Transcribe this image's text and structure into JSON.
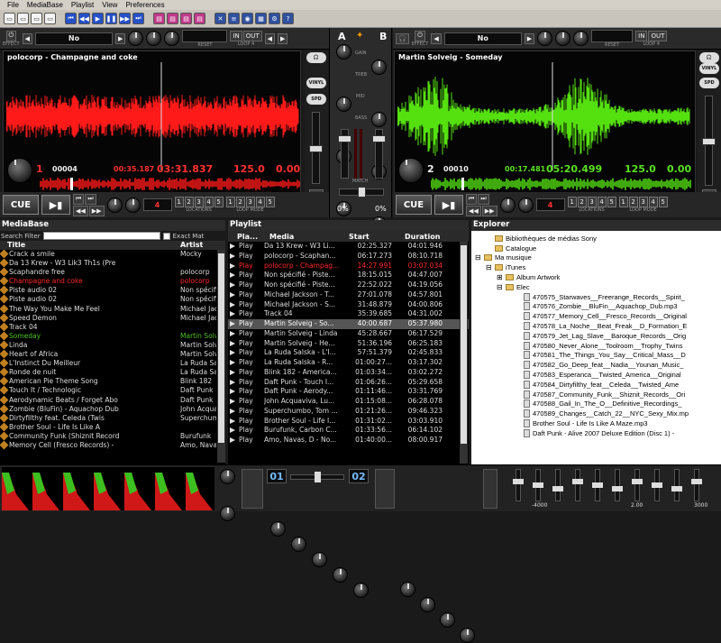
{
  "menu": [
    "File",
    "MediaBase",
    "Playlist",
    "View",
    "Preferences"
  ],
  "deckA": {
    "effect": "No",
    "effect_label": "EFFECT",
    "reset_label": "RESET",
    "in_label": "IN",
    "out_label": "OUT",
    "loop_label": "LOOP 4",
    "title": "polocorp - Champagne and coke",
    "deck_number": "1",
    "beat_counter": "00004",
    "elapsed": "00:35.187",
    "remaining": "03:31.837",
    "bpm": "125.0",
    "pitch": "0.00",
    "vinyl_label": "VINYL",
    "spd_label": "SPD",
    "cue_label": "CUE",
    "loop_len": "4",
    "loop_numbers": [
      "1",
      "2",
      "3",
      "4",
      "5"
    ],
    "locations_label": "LOCATIONS",
    "loop_mode_label": "LOOP MODE",
    "wave_color": "#ff1a1a"
  },
  "deckB": {
    "effect": "No",
    "effect_label": "EFFECT",
    "reset_label": "RESET",
    "in_label": "IN",
    "out_label": "OUT",
    "loop_label": "LOOP 4",
    "title": "Martin Solveig - Someday",
    "deck_number": "2",
    "beat_counter": "00010",
    "elapsed": "00:17.481",
    "remaining": "05:20.499",
    "bpm": "125.0",
    "pitch": "0.00",
    "vinyl_label": "VINYL",
    "spd_label": "SPD",
    "cue_label": "CUE",
    "loop_len": "4",
    "loop_numbers": [
      "1",
      "2",
      "3",
      "4",
      "5"
    ],
    "locations_label": "LOCATIONS",
    "loop_mode_label": "LOOP MODE",
    "wave_color": "#55e010"
  },
  "mixer": {
    "a_label": "A",
    "b_label": "B",
    "gain_label": "GAIN",
    "treb_label": "TREB",
    "mid_label": "MID",
    "bass_label": "BASS",
    "match_label": "MATCH",
    "pitch_a": "0%",
    "pitch_b": "0%"
  },
  "mediabase": {
    "title": "MediaBase",
    "search_label": "Search Filter",
    "exact_label": "Exact Mat",
    "col_title": "Title",
    "col_artist": "Artist",
    "rows": [
      {
        "title": "Crack a smile",
        "artist": "Mocky",
        "color": "#dddddd"
      },
      {
        "title": "Da 13 Krew - W3 Lik3 Th1s (Pre",
        "artist": "",
        "color": "#dddddd"
      },
      {
        "title": "Scaphandre free",
        "artist": "polocorp",
        "color": "#dddddd"
      },
      {
        "title": "Champagne and coke",
        "artist": "polocorp",
        "color": "#ff2a2a"
      },
      {
        "title": "Piste audio 02",
        "artist": "Non spécifié",
        "color": "#dddddd"
      },
      {
        "title": "Piste audio 02",
        "artist": "Non spécifié",
        "color": "#dddddd"
      },
      {
        "title": "The Way You Make Me Feel",
        "artist": "Michael Jackson",
        "color": "#dddddd"
      },
      {
        "title": "Speed Demon",
        "artist": "Michael Jackson",
        "color": "#dddddd"
      },
      {
        "title": "Track 04",
        "artist": "",
        "color": "#dddddd"
      },
      {
        "title": "Someday",
        "artist": "Martin Solveig",
        "color": "#4cc020"
      },
      {
        "title": "Linda",
        "artist": "Martin Solveig",
        "color": "#dddddd"
      },
      {
        "title": "Heart of Africa",
        "artist": "Martin Solveig",
        "color": "#dddddd"
      },
      {
        "title": "L'Instinct Du Meilleur",
        "artist": "La Ruda Salska",
        "color": "#dddddd"
      },
      {
        "title": "Ronde de nuit",
        "artist": "La Ruda Salska",
        "color": "#dddddd"
      },
      {
        "title": "American Pie Theme Song",
        "artist": "Blink 182",
        "color": "#dddddd"
      },
      {
        "title": "Touch It / Technologic",
        "artist": "Daft Punk",
        "color": "#dddddd"
      },
      {
        "title": "Aerodynamic Beats / Forget Abo",
        "artist": "Daft Punk",
        "color": "#dddddd"
      },
      {
        "title": "Zombie (BluFin) - Aquachop Dub",
        "artist": "John Acquaviva",
        "color": "#dddddd"
      },
      {
        "title": "Dirtyfilthy feat. Celeda (Twis",
        "artist": "Superchumbo",
        "color": "#dddddd"
      },
      {
        "title": "Brother Soul - Life Is Like A",
        "artist": "",
        "color": "#dddddd"
      },
      {
        "title": "Community Funk (Shiznit Record",
        "artist": "Burufunk",
        "color": "#dddddd"
      },
      {
        "title": "Memory Cell (Fresco Records) -",
        "artist": "Amo, Navas",
        "color": "#dddddd"
      }
    ]
  },
  "playlist": {
    "title": "Playlist",
    "col_play": "Pla...",
    "col_media": "Media",
    "col_start": "Start",
    "col_duration": "Duration",
    "rows": [
      {
        "p": "Play",
        "m": "Da 13 Krew - W3 Li...",
        "s": "02:25.327",
        "d": "04:01.946",
        "color": "#dddddd",
        "bg": "#000000"
      },
      {
        "p": "Play",
        "m": "polocorp - Scaphan...",
        "s": "06:17.273",
        "d": "08:10.718",
        "color": "#dddddd",
        "bg": "#000000"
      },
      {
        "p": "Play",
        "m": "polocorp - Champag...",
        "s": "14:27.991",
        "d": "03:07.034",
        "color": "#ff2a2a",
        "bg": "#000000"
      },
      {
        "p": "Play",
        "m": "Non spécifié - Piste...",
        "s": "18:15.015",
        "d": "04:47.007",
        "color": "#dddddd",
        "bg": "#000000"
      },
      {
        "p": "Play",
        "m": "Non spécifié - Piste...",
        "s": "22:52.022",
        "d": "04:19.056",
        "color": "#dddddd",
        "bg": "#000000"
      },
      {
        "p": "Play",
        "m": "Michael Jackson - T...",
        "s": "27:01.078",
        "d": "04:57.801",
        "color": "#dddddd",
        "bg": "#000000"
      },
      {
        "p": "Play",
        "m": "Michael Jackson - S...",
        "s": "31:48.879",
        "d": "04:00.806",
        "color": "#dddddd",
        "bg": "#000000"
      },
      {
        "p": "Play",
        "m": "Track 04",
        "s": "35:39.685",
        "d": "04:31.002",
        "color": "#dddddd",
        "bg": "#000000"
      },
      {
        "p": "Play",
        "m": "Martin Solveig - So...",
        "s": "40:00.687",
        "d": "05:37.980",
        "color": "#ffffff",
        "bg": "#555555"
      },
      {
        "p": "Play",
        "m": "Martin Solveig - Linda",
        "s": "45:28.667",
        "d": "06:17.529",
        "color": "#dddddd",
        "bg": "#000000"
      },
      {
        "p": "Play",
        "m": "Martin Solveig - He...",
        "s": "51:36.196",
        "d": "06:25.183",
        "color": "#dddddd",
        "bg": "#000000"
      },
      {
        "p": "Play",
        "m": "La Ruda Salska - L'I...",
        "s": "57:51.379",
        "d": "02:45.833",
        "color": "#dddddd",
        "bg": "#000000"
      },
      {
        "p": "Play",
        "m": "La Ruda Salska - R...",
        "s": "01:00:27...",
        "d": "03:17.302",
        "color": "#dddddd",
        "bg": "#000000"
      },
      {
        "p": "Play",
        "m": "Blink 182 - America...",
        "s": "01:03:34...",
        "d": "03:02.272",
        "color": "#dddddd",
        "bg": "#000000"
      },
      {
        "p": "Play",
        "m": "Daft Punk - Touch I...",
        "s": "01:06:26...",
        "d": "05:29.658",
        "color": "#dddddd",
        "bg": "#000000"
      },
      {
        "p": "Play",
        "m": "Daft Punk - Aerody...",
        "s": "01:11:46...",
        "d": "03:31.769",
        "color": "#dddddd",
        "bg": "#000000"
      },
      {
        "p": "Play",
        "m": "John Acquaviva, Lu...",
        "s": "01:15:08...",
        "d": "06:28.078",
        "color": "#dddddd",
        "bg": "#000000"
      },
      {
        "p": "Play",
        "m": "Superchumbo, Tom ...",
        "s": "01:21:26...",
        "d": "09:46.323",
        "color": "#dddddd",
        "bg": "#000000"
      },
      {
        "p": "Play",
        "m": "Brother Soul - Life I...",
        "s": "01:31:02...",
        "d": "03:03.910",
        "color": "#dddddd",
        "bg": "#000000"
      },
      {
        "p": "Play",
        "m": "Burufunk, Carbon C...",
        "s": "01:33:56...",
        "d": "06:14.102",
        "color": "#dddddd",
        "bg": "#000000"
      },
      {
        "p": "Play",
        "m": "Amo, Navas, D - No...",
        "s": "01:40:00...",
        "d": "08:00.917",
        "color": "#dddddd",
        "bg": "#000000"
      }
    ]
  },
  "explorer": {
    "title": "Explorer",
    "items": [
      {
        "label": "Bibliothèques de médias Sony",
        "indent": 1,
        "type": "folder"
      },
      {
        "label": "Catalogue",
        "indent": 1,
        "type": "folder"
      },
      {
        "label": "Ma musique",
        "indent": 0,
        "type": "folder",
        "toggle": "⊟"
      },
      {
        "label": "iTunes",
        "indent": 1,
        "type": "folder",
        "toggle": "⊟"
      },
      {
        "label": "Album Artwork",
        "indent": 2,
        "type": "folder",
        "toggle": "⊞"
      },
      {
        "label": "Elec",
        "indent": 2,
        "type": "folder",
        "toggle": "⊟"
      },
      {
        "label": "470575_Starwaves__Freerange_Records__Spirit_",
        "indent": 3,
        "type": "file"
      },
      {
        "label": "470576_Zombie__BluFin__Aquachop_Dub.mp3",
        "indent": 3,
        "type": "file"
      },
      {
        "label": "470577_Memory_Cell__Fresco_Records__Original",
        "indent": 3,
        "type": "file"
      },
      {
        "label": "470578_La_Noche__Beat_Freak__D_Formation_E",
        "indent": 3,
        "type": "file"
      },
      {
        "label": "470579_Jet_Lag_Slave__Baroque_Records__Orig",
        "indent": 3,
        "type": "file"
      },
      {
        "label": "470580_Never_Alone__Toolroom__Trophy_Twins",
        "indent": 3,
        "type": "file"
      },
      {
        "label": "470581_The_Things_You_Say__Critical_Mass__D",
        "indent": 3,
        "type": "file"
      },
      {
        "label": "470582_Go_Deep_feat__Nadia__Younan_Music_",
        "indent": 3,
        "type": "file"
      },
      {
        "label": "470583_Esperanca__Twisted_America__Original",
        "indent": 3,
        "type": "file"
      },
      {
        "label": "470584_Dirtyfilthy_feat__Celeda__Twisted_Ame",
        "indent": 3,
        "type": "file"
      },
      {
        "label": "470587_Community_Funk__Shiznit_Records__Ori",
        "indent": 3,
        "type": "file"
      },
      {
        "label": "470588_Gail_In_The_O__Definitive_Recordings_",
        "indent": 3,
        "type": "file"
      },
      {
        "label": "470589_Changes__Catch_22__NYC_Sexy_Mix.mp",
        "indent": 3,
        "type": "file"
      },
      {
        "label": "Brother Soul - Life Is Like A Maze.mp3",
        "indent": 3,
        "type": "file"
      },
      {
        "label": "Daft Punk - Alive 2007 Deluxe Edition (Disc 1) -",
        "indent": 3,
        "type": "file"
      }
    ]
  },
  "bottom": {
    "sampler_left": "01",
    "sampler_right": "02",
    "eq_labels": [
      "-4000",
      "2.00",
      "3000"
    ]
  }
}
